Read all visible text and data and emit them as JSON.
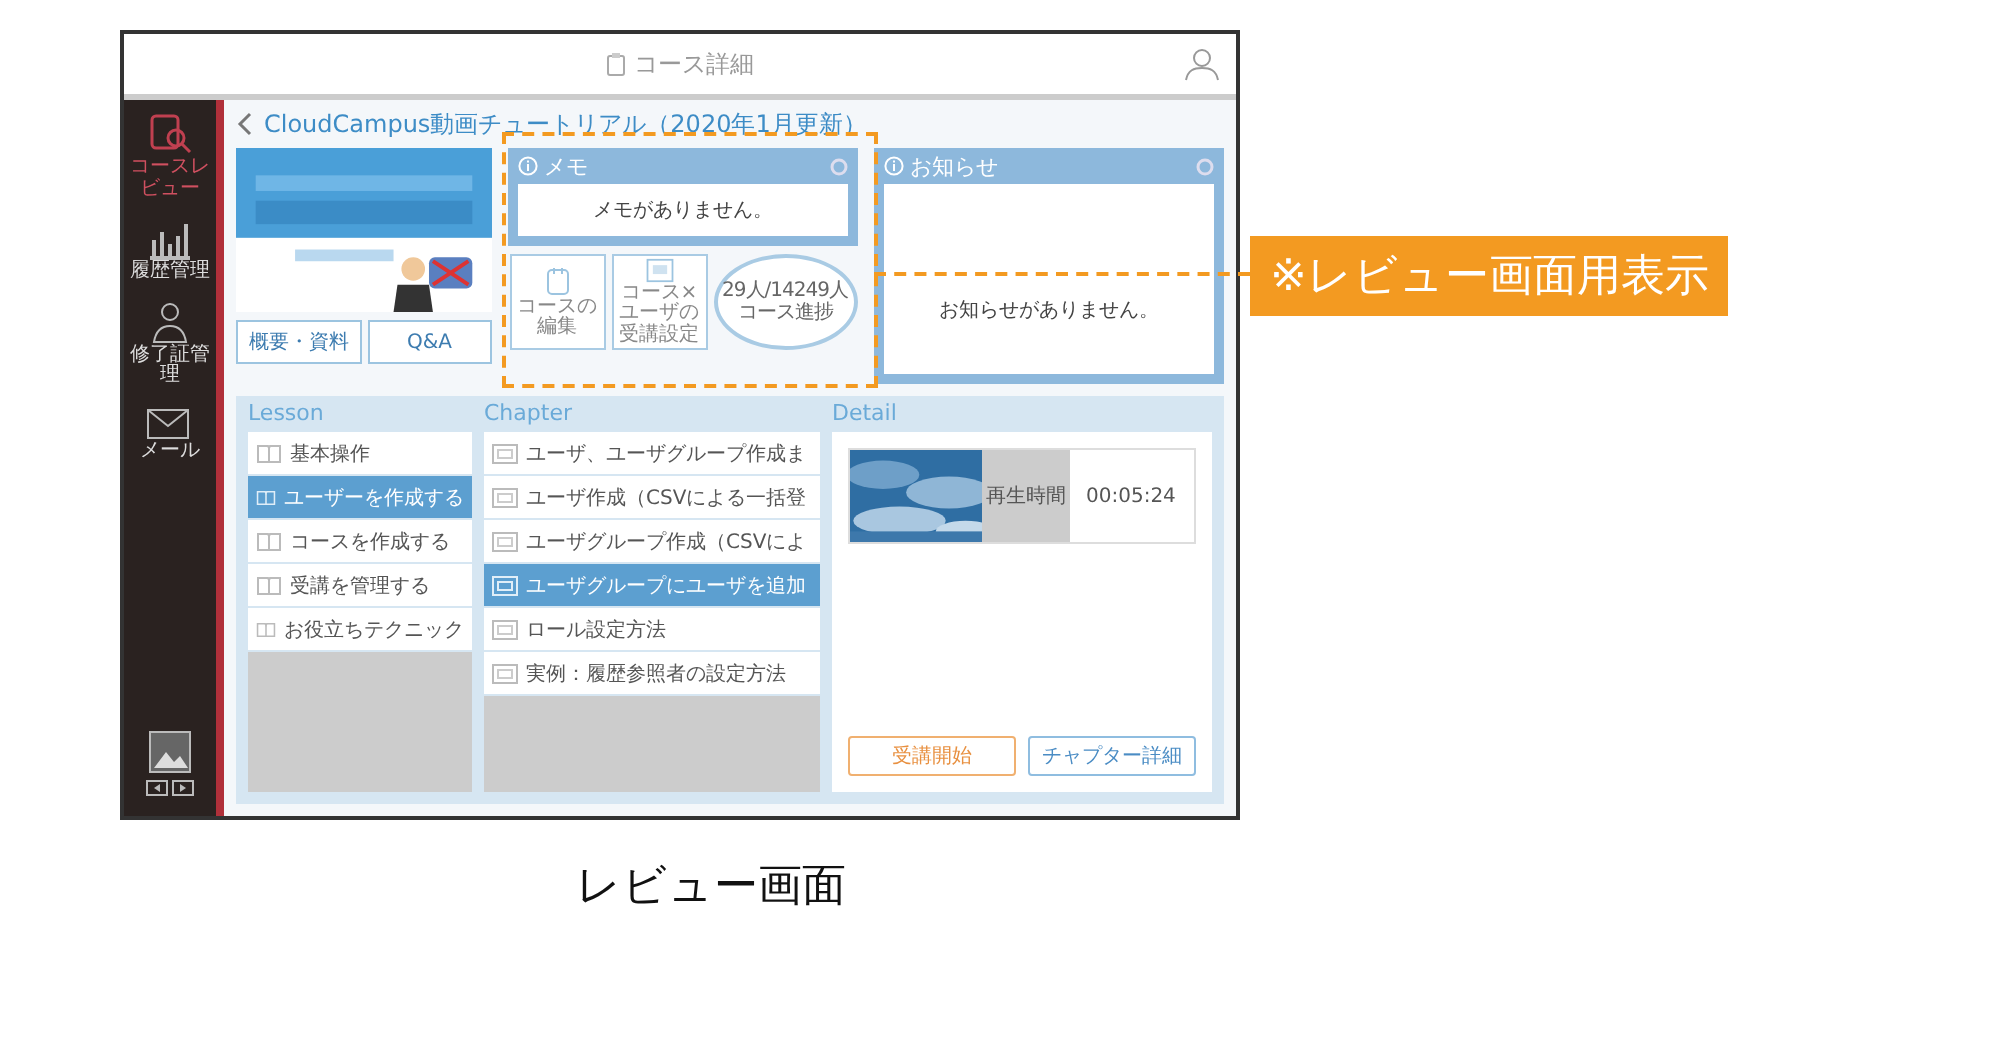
{
  "window": {
    "title": "コース詳細"
  },
  "sidebar": {
    "items": [
      {
        "label": "コースレビュー",
        "selected": true
      },
      {
        "label": "履歴管理",
        "selected": false
      },
      {
        "label": "修了証管理",
        "selected": false
      },
      {
        "label": "メール",
        "selected": false
      }
    ]
  },
  "course": {
    "title": "CloudCampus動画チュートリアル（2020年1月更新）",
    "banner": {
      "kind": "picture"
    },
    "buttons": [
      "概要・資料",
      "Q&A"
    ]
  },
  "memo": {
    "title": "メモ",
    "message": "メモがありません。"
  },
  "actions": [
    {
      "kind": "tile",
      "label": "コースの編集"
    },
    {
      "kind": "tile",
      "label": "コース×ユーザの受講設定"
    },
    {
      "kind": "progress",
      "label": "29人/14249人",
      "caption": "コース進捗"
    }
  ],
  "notice": {
    "title": "お知らせ",
    "message": "お知らせがありません。"
  },
  "lessons": {
    "heading": "Lesson",
    "items": [
      {
        "label": "基本操作",
        "selected": false
      },
      {
        "label": "ユーザーを作成する",
        "selected": true
      },
      {
        "label": "コースを作成する",
        "selected": false
      },
      {
        "label": "受講を管理する",
        "selected": false
      },
      {
        "label": "お役立ちテクニック",
        "selected": false
      }
    ]
  },
  "chapters": {
    "heading": "Chapter",
    "items": [
      {
        "label": "ユーザ、ユーザグループ作成ま",
        "selected": false
      },
      {
        "label": "ユーザ作成（CSVによる一括登",
        "selected": false
      },
      {
        "label": "ユーザグループ作成（CSVによ",
        "selected": false
      },
      {
        "label": "ユーザグループにユーザを追加",
        "selected": true
      },
      {
        "label": "ロール設定方法",
        "selected": false
      },
      {
        "label": "実例：履歴参照者の設定方法",
        "selected": false
      }
    ]
  },
  "detail": {
    "heading": "Detail",
    "thumbnail": {
      "kind": "picture"
    },
    "duration_label": "再生時間",
    "duration": "00:05:24",
    "buttons": [
      {
        "label": "受講開始",
        "kind": "start"
      },
      {
        "label": "チャプター詳細",
        "kind": "info"
      }
    ]
  },
  "annotation": "※レビュー画面用表示",
  "caption": "レビュー画面"
}
